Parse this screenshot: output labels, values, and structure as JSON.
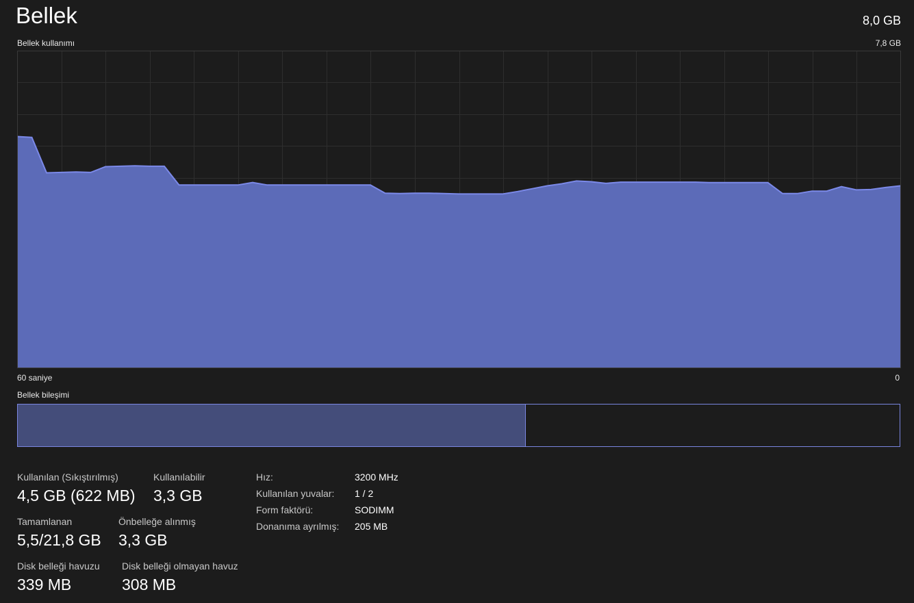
{
  "header": {
    "title": "Bellek",
    "total": "8,0 GB"
  },
  "chart": {
    "label": "Bellek kullanımı",
    "max_label": "7,8 GB",
    "x_left_label": "60 saniye",
    "x_right_label": "0",
    "line_color": "#7b89e8",
    "fill_color": "#5c6bb8",
    "grid_color": "#2e2e2e"
  },
  "chart_data": {
    "type": "area",
    "xlabel": "",
    "ylabel": "Bellek kullanımı",
    "ylim": [
      0,
      7.8
    ],
    "grid": true,
    "y_unit": "GB",
    "x": [
      60,
      59,
      58,
      57,
      56,
      55,
      54,
      53,
      52,
      51,
      50,
      49,
      48,
      47,
      46,
      45,
      44,
      43,
      42,
      41,
      40,
      39,
      38,
      37,
      36,
      35,
      34,
      33,
      32,
      31,
      30,
      29,
      28,
      27,
      26,
      25,
      24,
      23,
      22,
      21,
      20,
      19,
      18,
      17,
      16,
      15,
      14,
      13,
      12,
      11,
      10,
      9,
      8,
      7,
      6,
      5,
      4,
      3,
      2,
      1,
      0
    ],
    "values": [
      5.69,
      5.67,
      4.8,
      4.81,
      4.82,
      4.81,
      4.95,
      4.96,
      4.97,
      4.96,
      4.96,
      4.5,
      4.5,
      4.5,
      4.5,
      4.5,
      4.56,
      4.5,
      4.5,
      4.5,
      4.5,
      4.5,
      4.5,
      4.5,
      4.5,
      4.3,
      4.29,
      4.3,
      4.3,
      4.29,
      4.28,
      4.28,
      4.28,
      4.28,
      4.34,
      4.41,
      4.48,
      4.53,
      4.6,
      4.58,
      4.54,
      4.57,
      4.57,
      4.57,
      4.57,
      4.57,
      4.57,
      4.56,
      4.56,
      4.56,
      4.56,
      4.56,
      4.29,
      4.29,
      4.35,
      4.35,
      4.46,
      4.38,
      4.39,
      4.44,
      4.48
    ]
  },
  "composition": {
    "label": "Bellek bileşimi",
    "in_use_fraction": 0.575,
    "color": "#444d7a",
    "border_color": "#7a86e0"
  },
  "stats": {
    "used_label": "Kullanılan (Sıkıştırılmış)",
    "used_value": "4,5 GB (622 MB)",
    "available_label": "Kullanılabilir",
    "available_value": "3,3 GB",
    "committed_label": "Tamamlanan",
    "committed_value": "5,5/21,8 GB",
    "cached_label": "Önbelleğe alınmış",
    "cached_value": "3,3 GB",
    "paged_label": "Disk belleği havuzu",
    "paged_value": "339 MB",
    "nonpaged_label": "Disk belleği olmayan havuz",
    "nonpaged_value": "308 MB"
  },
  "details": {
    "speed_label": "Hız:",
    "speed_value": "3200 MHz",
    "slots_label": "Kullanılan yuvalar:",
    "slots_value": "1 / 2",
    "form_label": "Form faktörü:",
    "form_value": "SODIMM",
    "reserved_label": "Donanıma ayrılmış:",
    "reserved_value": "205 MB"
  }
}
